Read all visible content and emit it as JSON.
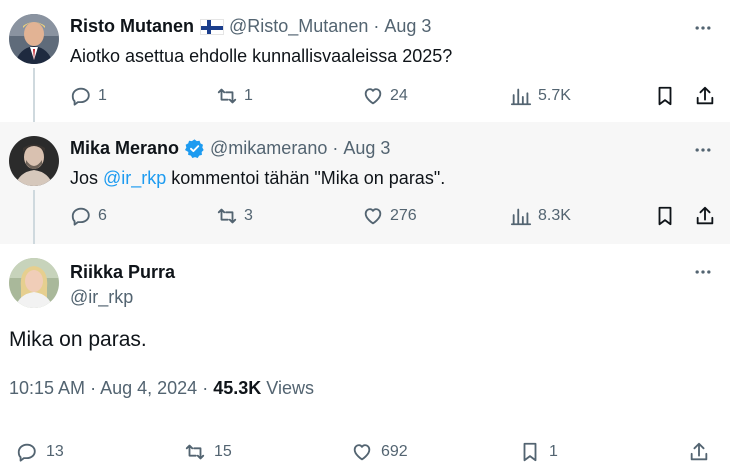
{
  "tweets": [
    {
      "name": "Risto Mutanen",
      "handle": "@Risto_Mutanen",
      "dot": "·",
      "date": "Aug 3",
      "text": "Aiotko asettua ehdolle kunnallisvaaleissa 2025?",
      "stats": {
        "replies": "1",
        "retweets": "1",
        "likes": "24",
        "views": "5.7K"
      }
    },
    {
      "name": "Mika Merano",
      "handle": "@mikamerano",
      "dot": "·",
      "date": "Aug 3",
      "text_prefix": "Jos ",
      "mention": "@ir_rkp",
      "text_suffix": " kommentoi tähän \"Mika on paras\".",
      "stats": {
        "replies": "6",
        "retweets": "3",
        "likes": "276",
        "views": "8.3K"
      }
    }
  ],
  "main": {
    "name": "Riikka Purra",
    "handle": "@ir_rkp",
    "text": "Mika on paras.",
    "time": "10:15 AM",
    "dot": "·",
    "date": "Aug 4, 2024",
    "dot2": "·",
    "views_count": "45.3K",
    "views_label": "Views",
    "stats": {
      "replies": "13",
      "retweets": "15",
      "likes": "692",
      "bookmarks": "1"
    }
  },
  "colors": {
    "accent": "#1d9bf0",
    "muted": "#536471",
    "text": "#0f1419"
  }
}
